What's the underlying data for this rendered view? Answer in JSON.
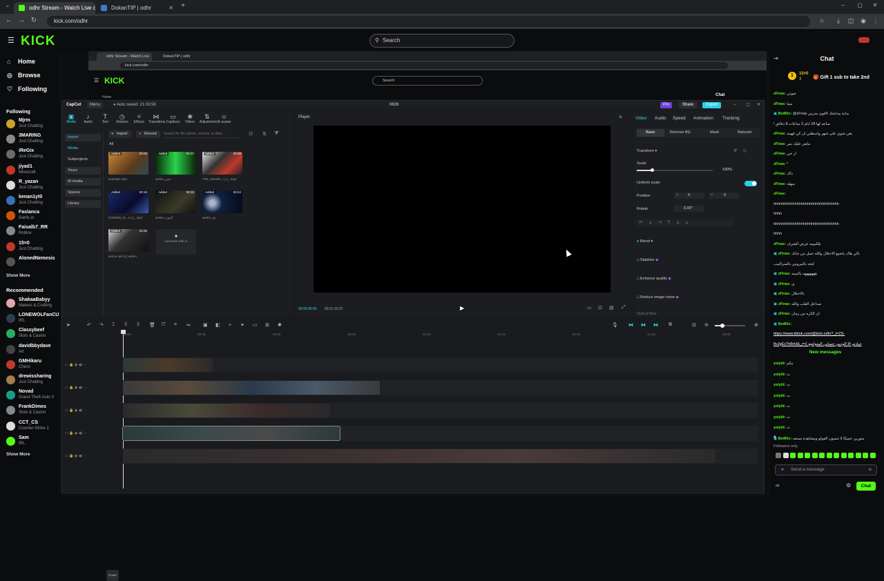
{
  "browser": {
    "tabs": [
      {
        "label": "odhr Stream - Watch Live on K",
        "active": true
      },
      {
        "label": "DokanTIP | odhr",
        "active": false
      }
    ],
    "url": "kick.com/odhr"
  },
  "kick": {
    "logo": "KICK",
    "search_placeholder": "Search",
    "nav": [
      "Home",
      "Browse",
      "Following"
    ],
    "following_header": "Following",
    "following": [
      {
        "name": "Mjrm",
        "category": "Just Chatting",
        "color": "#c9a227"
      },
      {
        "name": "3MARING",
        "category": "Just Chatting",
        "color": "#8a8a8a"
      },
      {
        "name": "iReGix",
        "category": "Just Chatting",
        "color": "#6b6b6b"
      },
      {
        "name": "jiyad1",
        "category": "Minecraft",
        "color": "#c0392b"
      },
      {
        "name": "R_yazan",
        "category": "Just Chatting",
        "color": "#dddddd"
      },
      {
        "name": "kenan1yt0",
        "category": "Just Chatting",
        "color": "#3b6fb6"
      },
      {
        "name": "Faslanca",
        "category": "Gartic.io",
        "color": "#d35400"
      },
      {
        "name": "Faisalb7_RR",
        "category": "Roblox",
        "color": "#7f8c8d"
      },
      {
        "name": "15×0",
        "category": "Just Chatting",
        "color": "#c0392b"
      },
      {
        "name": "AlonedNemesis",
        "category": "",
        "color": "#555555"
      }
    ],
    "show_more": "Show More",
    "recommended_header": "Recommended",
    "recommended": [
      {
        "name": "ShakaaBabyy",
        "category": "Makers & Crafting",
        "color": "#e0a6b0"
      },
      {
        "name": "LONEWOLFanCU",
        "category": "IRL",
        "color": "#2c3e50"
      },
      {
        "name": "Classybeef",
        "category": "Slots & Casino",
        "color": "#27ae60"
      },
      {
        "name": "davidbbydave",
        "category": "Art",
        "color": "#444444"
      },
      {
        "name": "GMHikaru",
        "category": "Chess",
        "color": "#c0392b"
      },
      {
        "name": "drewissharing",
        "category": "Just Chatting",
        "color": "#a67c52"
      },
      {
        "name": "Novad",
        "category": "Grand Theft Auto V",
        "color": "#16a085"
      },
      {
        "name": "FrankDimes",
        "category": "Slots & Casino",
        "color": "#7f8c8d"
      },
      {
        "name": "CCT_CS",
        "category": "Counter-Strike 2",
        "color": "#dddddd"
      },
      {
        "name": "Sam",
        "category": "IRL",
        "color": "#53fc18"
      }
    ],
    "show_more_2": "Show More"
  },
  "inner": {
    "tabs": [
      "odhr Stream - Watch Live on K",
      "DokanTIP | odhr"
    ],
    "url": "kick.com/odhr",
    "logo": "KICK",
    "search_placeholder": "Search",
    "nested_tabs": [
      "Home",
      "Chat"
    ]
  },
  "capcut": {
    "app": "CapCut",
    "menu": "Menu",
    "autosave": "Auto saved: 21:03:58",
    "project": "0826",
    "pro": "Pro",
    "share": "Share",
    "export": "Export",
    "media_tools": [
      "Media",
      "Audio",
      "Text",
      "Stickers",
      "Effects",
      "Transitions",
      "Captions",
      "Filters",
      "Adjustment",
      "AI avatar"
    ],
    "categories": [
      "Import",
      "Media",
      "Subprojects",
      "Yours",
      "AI media",
      "Spaces",
      "Library"
    ],
    "import_btn": "Import",
    "record_btn": "Record",
    "media_search": "Search for file names, scenes, or dialo...",
    "all_label": "All",
    "thumbs": [
      {
        "tag": "Added",
        "dur": "00:08",
        "name": "example.mp4",
        "bg": "linear-gradient(135deg,#c98a3a,#5a3a1a 60%,#2c4a5a)"
      },
      {
        "tag": "Added",
        "dur": "00:37",
        "name": "webm.ذهبي",
        "bg": "linear-gradient(90deg,#0a2a0a,#2bd34a 50%,#0a2a0a)"
      },
      {
        "tag": "Added",
        "dur": "00:09",
        "name": "THE_SEARC...t_1_.mp4",
        "bg": "linear-gradient(135deg,#eee,#333 40%,#c0392b 70%,#222)"
      },
      {
        "tag": "Added",
        "dur": "00:18",
        "name": "COMING_N....rt_1_.mp4",
        "bg": "linear-gradient(135deg,#1a2a6a,#0a0a2a 60%,#3a5aaa)"
      },
      {
        "tag": "Added",
        "dur": "00:15",
        "name": "webm.الموت",
        "bg": "linear-gradient(135deg,#111,#3a3a2a 60%,#111)"
      },
      {
        "tag": "Added",
        "dur": "00:34",
        "name": "webm.تيار",
        "bg": "radial-gradient(circle at 25% 55%,#aab4d0 8%,#102040 30%,#050a18)"
      },
      {
        "tag": "Added",
        "dur": "01:05",
        "name": "anime sp!f (1).webm",
        "bg": "linear-gradient(135deg,#ddd,#333 40%,#111)"
      }
    ],
    "generate_ai": "Generate with AI",
    "player_title": "Player",
    "time_current": "00:00:00:00",
    "time_total": "00:01:19:22",
    "prop_tabs": [
      "Video",
      "Audio",
      "Speed",
      "Animation",
      "Tracking"
    ],
    "sub_tabs": [
      "Basic",
      "Remove BG",
      "Mask",
      "Retouch"
    ],
    "transform": "Transform",
    "scale": "Scale",
    "scale_val": "100%",
    "uniform_scale": "Uniform scale",
    "position": "Position",
    "pos_x_label": "X",
    "pos_x": "0",
    "pos_y_label": "Y",
    "pos_y": "0",
    "rotate": "Rotate",
    "rotate_val": "0.00°",
    "blend": "Blend",
    "stabilize": "Stabilize",
    "enhance": "Enhance quality",
    "noise": "Reduce image noise",
    "optical": "Optical flow",
    "ruler": [
      "00:00",
      "00:15",
      "00:30",
      "00:45",
      "01:00",
      "01:15",
      "01:30",
      "01:45",
      "02:00",
      "02:15",
      "02:30"
    ],
    "cover": "Cover"
  },
  "chat": {
    "title": "Chat",
    "gift_count": "1",
    "gift_user": "15×0",
    "gift_sub": "3",
    "gift_text": "Gift 1 sub to take 2nd",
    "messages": [
      {
        "u": "zFiras:",
        "t": "عيوني",
        "c": "#53fc18"
      },
      {
        "u": "zFiras:",
        "t": "متيا",
        "c": "#53fc18"
      },
      {
        "u": "BotRix:",
        "t": "@zFiras بداية مذابحك لاقوى مترس",
        "c": "#53fc18",
        "bot": true
      },
      {
        "u": "",
        "t": "! ساعه لها 28 ايام 3 ساعات 8 دقائق",
        "c": "#53fc18"
      },
      {
        "u": "zFiras:",
        "t": "بقي شوي على شهر واسطتي ان كي فهيبه",
        "c": "#53fc18"
      },
      {
        "u": "zFiras:",
        "t": "مايعر عليك نمر",
        "c": "#53fc18"
      },
      {
        "u": "zFiras:",
        "t": "ار جي",
        "c": "#53fc18"
      },
      {
        "u": "zFiras:",
        "t": "*",
        "c": "#53fc18"
      },
      {
        "u": "zFiras:",
        "t": "ذاك",
        "c": "#53fc18"
      },
      {
        "u": "zFiras:",
        "t": "سهله",
        "c": "#53fc18"
      },
      {
        "u": "zFiras:",
        "t": "",
        "c": "#53fc18"
      },
      {
        "u": "",
        "t": "hhhhhhhhhhhhhhhhhhhhhhhhhhhhhhh",
        "c": "#53fc18"
      },
      {
        "u": "",
        "t": "hhhh",
        "c": "#53fc18"
      },
      {
        "u": "",
        "t": "hhhhhhhhhhhhhhhhhhhhhhhhhhhhhhh",
        "c": "#53fc18"
      },
      {
        "u": "",
        "t": "hhhh",
        "c": "#53fc18"
      },
      {
        "u": "zFiras:",
        "t": "يلللبيييه عرض الشرف",
        "c": "#53fc18"
      },
      {
        "u": "zFiras:",
        "t": "بالي هاك يانجيع الاحتلال والله جمل من جانك",
        "c": "#53fc18",
        "bot": true
      },
      {
        "u": "",
        "t": "لتجد بالبيروبين بالسرالبيب",
        "c": "#53fc18"
      },
      {
        "u": "zFiras:",
        "t": "هههههههه يالبببيه",
        "c": "#53fc18",
        "bot": true
      },
      {
        "u": "zFiras:",
        "t": "ي",
        "c": "#53fc18",
        "bot": true
      },
      {
        "u": "zFiras:",
        "t": "بالاحتلال",
        "c": "#53fc18",
        "bot": true
      },
      {
        "u": "zFiras:",
        "t": "صداعل القلب والله",
        "c": "#53fc18",
        "bot": true
      },
      {
        "u": "zFiras:",
        "t": "ان الكره من زمان",
        "c": "#53fc18",
        "bot": true
      },
      {
        "u": "BotRix:",
        "t": "",
        "c": "#53fc18",
        "bot": true
      },
      {
        "u": "",
        "t": "https://www.tiktok.com/@kick.odhr?_t=ZS-",
        "c": "#ffffff"
      },
      {
        "u": "",
        "t": "8vJgEz7h8nH&_r=1 حيادتم الا الوديين حسابي المتواضع",
        "c": "#ffffff"
      }
    ],
    "new_messages": "New messages",
    "new": [
      {
        "u": "yslyld:",
        "t": "مكم"
      },
      {
        "u": "yslyld:",
        "t": "ث"
      },
      {
        "u": "yslyld:",
        "t": "ث"
      },
      {
        "u": "yslyld:",
        "t": "ث"
      },
      {
        "u": "yslyld:",
        "t": "ث"
      },
      {
        "u": "yslyld:",
        "t": "ث"
      },
      {
        "u": "yslyld:",
        "t": "ث"
      },
      {
        "u": "BotRix:",
        "t": "متورين جميكا لا تنسون الفولو ومشاهدة ممتعه"
      }
    ],
    "heart": "♥",
    "followers_only": "Followers only",
    "input_placeholder": "Send a message",
    "chat_button": "Chat"
  }
}
